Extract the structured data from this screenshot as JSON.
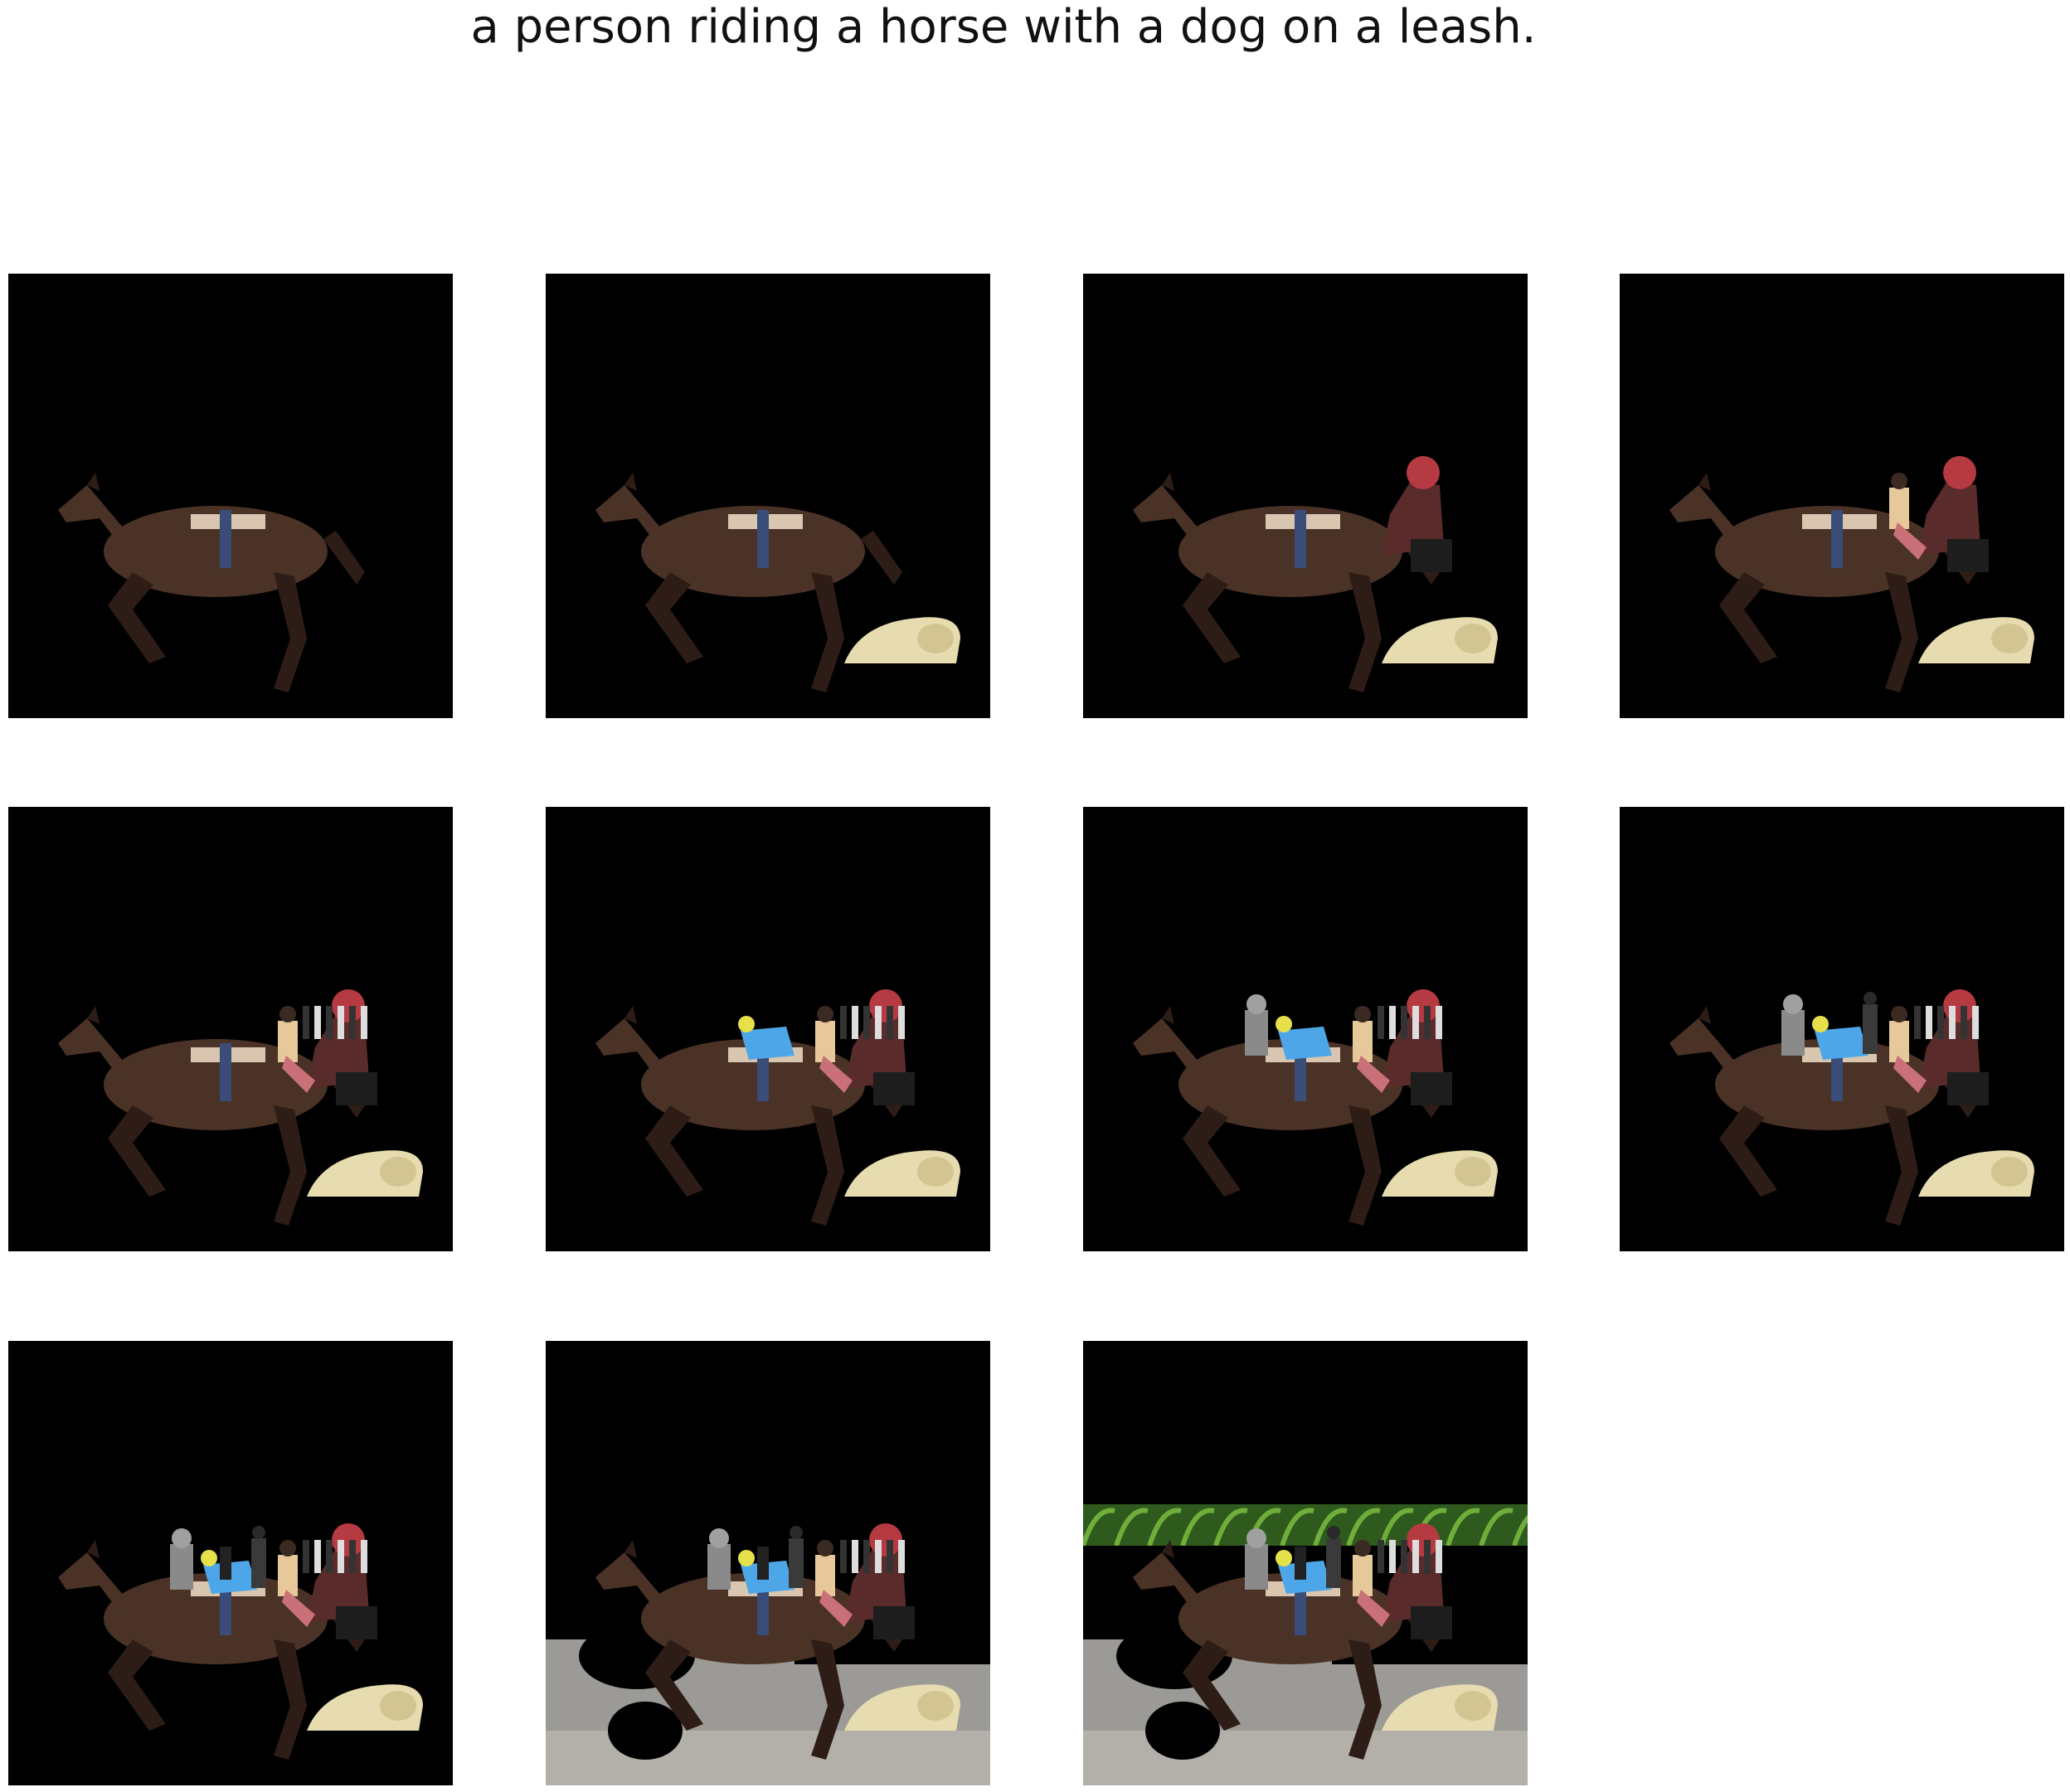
{
  "caption": "a person riding a horse with a dog on a leash.",
  "colors": {
    "background": "#ffffff",
    "canvas": "#000000",
    "horse": "#4a3226",
    "horse_dark": "#2d1d16",
    "dog": "#e6dcb0",
    "rider_top": "#5a2b2b",
    "helmet": "#b53a42",
    "child": "#e7c89a",
    "blue_figure": "#4da6e8",
    "gray_figure": "#8a8a8a",
    "dark_figure": "#3a3a3a",
    "pavement": "#9c9a96",
    "foliage": "#2f5a1e"
  },
  "frames": [
    {
      "id": 1,
      "layers": [
        "horse-icon"
      ]
    },
    {
      "id": 2,
      "layers": [
        "horse-icon",
        "dog-icon"
      ]
    },
    {
      "id": 3,
      "layers": [
        "horse-icon",
        "dog-icon",
        "rider-icon"
      ]
    },
    {
      "id": 4,
      "layers": [
        "horse-icon",
        "dog-icon",
        "rider-icon",
        "child-icon"
      ]
    },
    {
      "id": 5,
      "layers": [
        "horse-icon",
        "dog-icon",
        "rider-icon",
        "child-icon",
        "stripes-icon"
      ]
    },
    {
      "id": 6,
      "layers": [
        "horse-icon",
        "dog-icon",
        "rider-icon",
        "child-icon",
        "stripes-icon",
        "blue-figure-icon"
      ]
    },
    {
      "id": 7,
      "layers": [
        "horse-icon",
        "dog-icon",
        "rider-icon",
        "child-icon",
        "stripes-icon",
        "blue-figure-icon",
        "gray-figure-icon"
      ]
    },
    {
      "id": 8,
      "layers": [
        "horse-icon",
        "dog-icon",
        "rider-icon",
        "child-icon",
        "stripes-icon",
        "blue-figure-icon",
        "gray-figure-icon",
        "dark-figure-icon"
      ]
    },
    {
      "id": 9,
      "layers": [
        "horse-icon",
        "dog-icon",
        "rider-icon",
        "child-icon",
        "stripes-icon",
        "blue-figure-icon",
        "gray-figure-icon",
        "dark-figure-icon",
        "small-figure-icon"
      ]
    },
    {
      "id": 10,
      "layers": [
        "horse-icon",
        "dog-icon",
        "rider-icon",
        "child-icon",
        "stripes-icon",
        "blue-figure-icon",
        "gray-figure-icon",
        "dark-figure-icon",
        "small-figure-icon",
        "pavement-icon"
      ]
    },
    {
      "id": 11,
      "layers": [
        "horse-icon",
        "dog-icon",
        "rider-icon",
        "child-icon",
        "stripes-icon",
        "blue-figure-icon",
        "gray-figure-icon",
        "dark-figure-icon",
        "small-figure-icon",
        "pavement-icon",
        "foliage-icon"
      ]
    }
  ]
}
